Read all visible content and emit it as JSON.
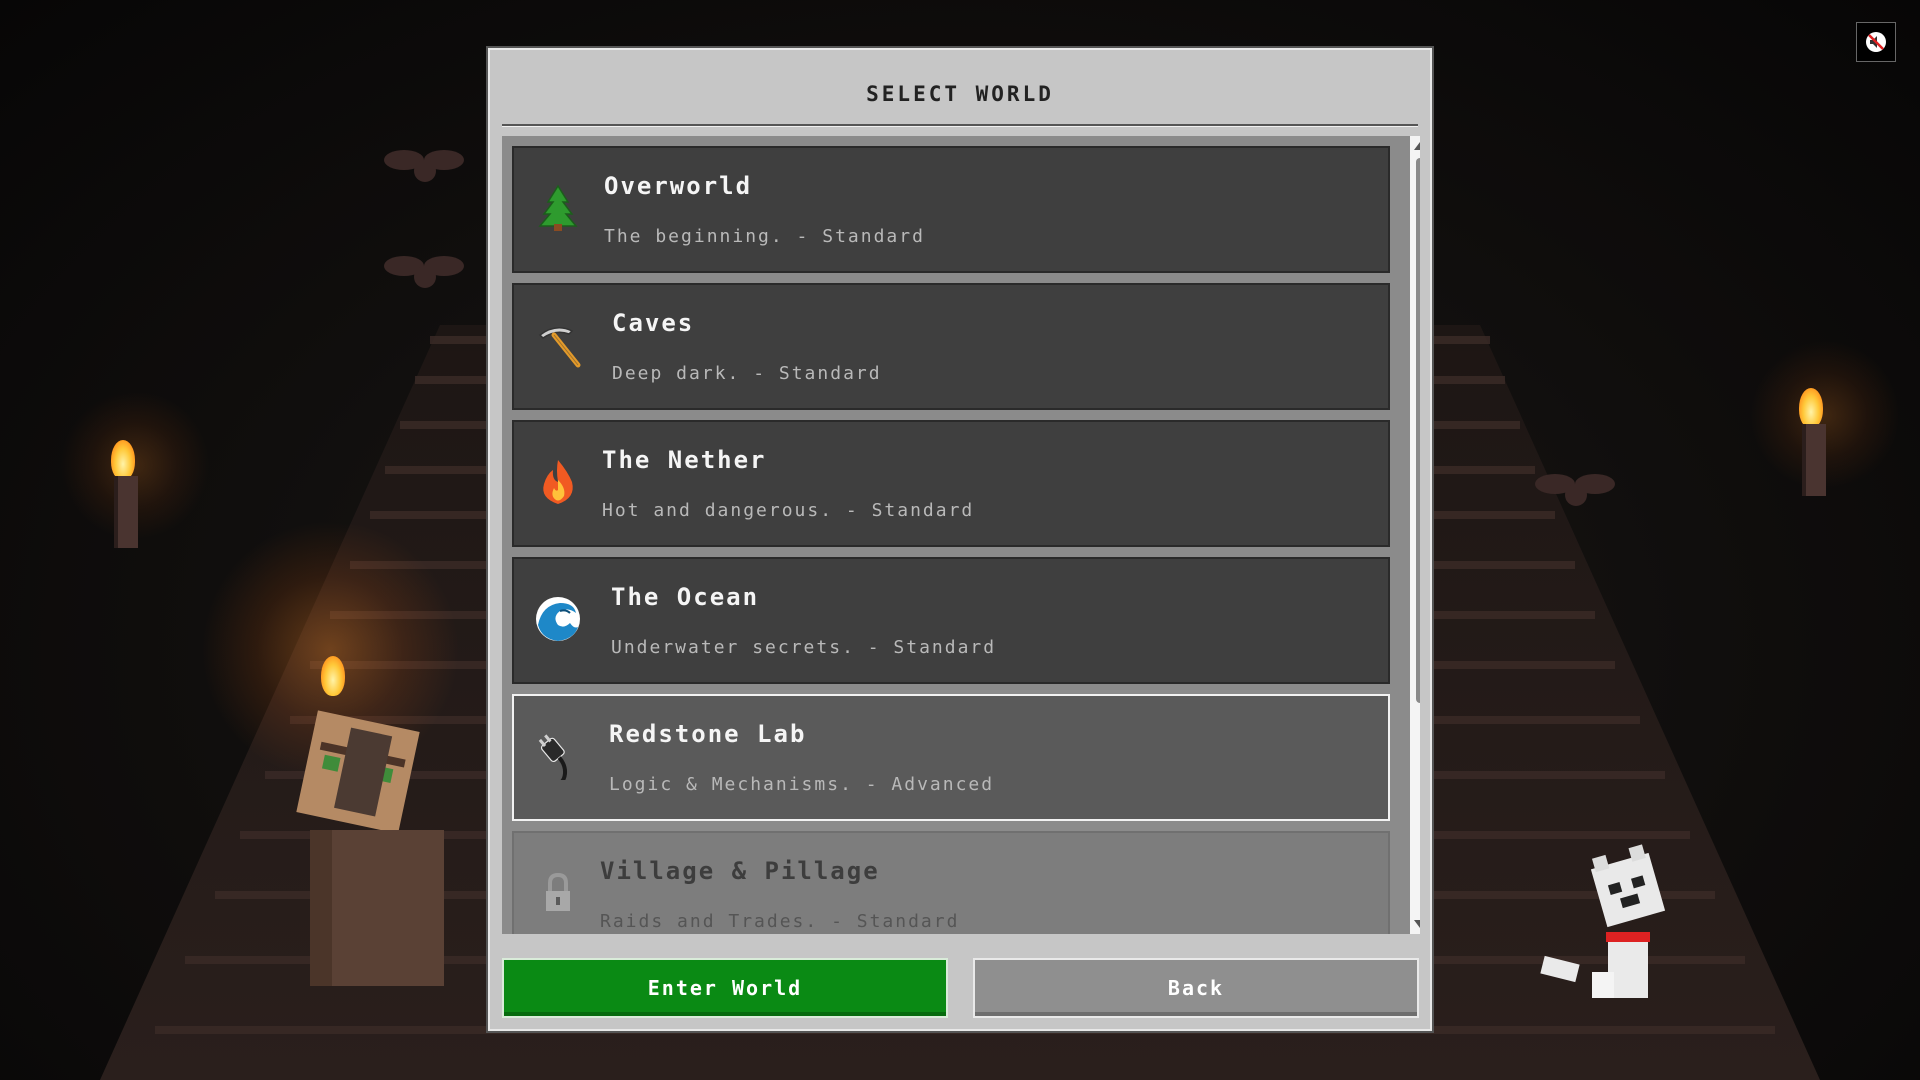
{
  "dialog": {
    "title": "SELECT WORLD"
  },
  "worlds": [
    {
      "name": "Overworld",
      "desc": "The beginning. - Standard",
      "icon": "tree-icon",
      "state": "normal"
    },
    {
      "name": "Caves",
      "desc": "Deep dark. - Standard",
      "icon": "pickaxe-icon",
      "state": "normal"
    },
    {
      "name": "The Nether",
      "desc": "Hot and dangerous. - Standard",
      "icon": "fire-icon",
      "state": "normal"
    },
    {
      "name": "The Ocean",
      "desc": "Underwater secrets. - Standard",
      "icon": "wave-icon",
      "state": "normal"
    },
    {
      "name": "Redstone Lab",
      "desc": "Logic & Mechanisms. - Advanced",
      "icon": "plug-icon",
      "state": "selected"
    },
    {
      "name": "Village & Pillage",
      "desc": "Raids and Trades. - Standard",
      "icon": "lock-icon",
      "state": "locked"
    }
  ],
  "buttons": {
    "enter": "Enter World",
    "back": "Back"
  },
  "colors": {
    "enter_button": "#0a8a14",
    "item_bg": "#3f3f3f",
    "item_selected_bg": "#5a5a5a",
    "item_locked_bg": "#7d7d7d",
    "dialog_bg": "#c6c6c6"
  },
  "icons": {
    "mute": "speaker-muted-icon"
  }
}
